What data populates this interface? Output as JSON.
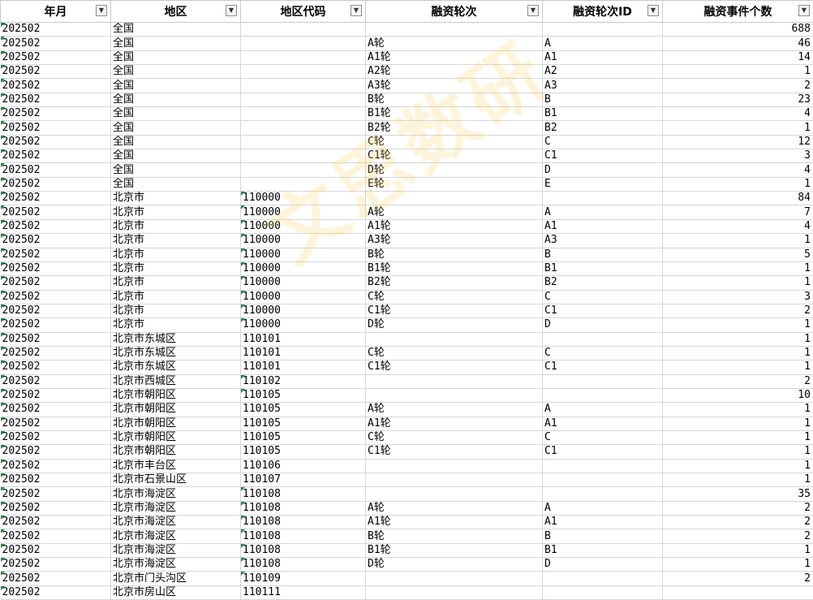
{
  "headers": [
    "年月",
    "地区",
    "地区代码",
    "融资轮次",
    "融资轮次ID",
    "融资事件个数"
  ],
  "filter_icons": [
    "filter-dropdown-icon",
    "filter-dropdown-icon",
    "filter-dropdown-icon",
    "filter-dropdown-icon",
    "filter-dropdown-icon",
    "filter-active-icon"
  ],
  "filter_glyph": "▼",
  "watermark": "文思数研",
  "colors": {
    "marker": "#1e8e3e",
    "watermark": "#f5cd5a"
  },
  "rows": [
    [
      "202502",
      "全国",
      "",
      "",
      "",
      "688"
    ],
    [
      "202502",
      "全国",
      "",
      "A轮",
      "A",
      "46"
    ],
    [
      "202502",
      "全国",
      "",
      "A1轮",
      "A1",
      "14"
    ],
    [
      "202502",
      "全国",
      "",
      "A2轮",
      "A2",
      "1"
    ],
    [
      "202502",
      "全国",
      "",
      "A3轮",
      "A3",
      "2"
    ],
    [
      "202502",
      "全国",
      "",
      "B轮",
      "B",
      "23"
    ],
    [
      "202502",
      "全国",
      "",
      "B1轮",
      "B1",
      "4"
    ],
    [
      "202502",
      "全国",
      "",
      "B2轮",
      "B2",
      "1"
    ],
    [
      "202502",
      "全国",
      "",
      "C轮",
      "C",
      "12"
    ],
    [
      "202502",
      "全国",
      "",
      "C1轮",
      "C1",
      "3"
    ],
    [
      "202502",
      "全国",
      "",
      "D轮",
      "D",
      "4"
    ],
    [
      "202502",
      "全国",
      "",
      "E轮",
      "E",
      "1"
    ],
    [
      "202502",
      "北京市",
      "110000",
      "",
      "",
      "84"
    ],
    [
      "202502",
      "北京市",
      "110000",
      "A轮",
      "A",
      "7"
    ],
    [
      "202502",
      "北京市",
      "110000",
      "A1轮",
      "A1",
      "4"
    ],
    [
      "202502",
      "北京市",
      "110000",
      "A3轮",
      "A3",
      "1"
    ],
    [
      "202502",
      "北京市",
      "110000",
      "B轮",
      "B",
      "5"
    ],
    [
      "202502",
      "北京市",
      "110000",
      "B1轮",
      "B1",
      "1"
    ],
    [
      "202502",
      "北京市",
      "110000",
      "B2轮",
      "B2",
      "1"
    ],
    [
      "202502",
      "北京市",
      "110000",
      "C轮",
      "C",
      "3"
    ],
    [
      "202502",
      "北京市",
      "110000",
      "C1轮",
      "C1",
      "2"
    ],
    [
      "202502",
      "北京市",
      "110000",
      "D轮",
      "D",
      "1"
    ],
    [
      "202502",
      "北京市东城区",
      "110101",
      "",
      "",
      "1"
    ],
    [
      "202502",
      "北京市东城区",
      "110101",
      "C轮",
      "C",
      "1"
    ],
    [
      "202502",
      "北京市东城区",
      "110101",
      "C1轮",
      "C1",
      "1"
    ],
    [
      "202502",
      "北京市西城区",
      "110102",
      "",
      "",
      "2"
    ],
    [
      "202502",
      "北京市朝阳区",
      "110105",
      "",
      "",
      "10"
    ],
    [
      "202502",
      "北京市朝阳区",
      "110105",
      "A轮",
      "A",
      "1"
    ],
    [
      "202502",
      "北京市朝阳区",
      "110105",
      "A1轮",
      "A1",
      "1"
    ],
    [
      "202502",
      "北京市朝阳区",
      "110105",
      "C轮",
      "C",
      "1"
    ],
    [
      "202502",
      "北京市朝阳区",
      "110105",
      "C1轮",
      "C1",
      "1"
    ],
    [
      "202502",
      "北京市丰台区",
      "110106",
      "",
      "",
      "1"
    ],
    [
      "202502",
      "北京市石景山区",
      "110107",
      "",
      "",
      "1"
    ],
    [
      "202502",
      "北京市海淀区",
      "110108",
      "",
      "",
      "35"
    ],
    [
      "202502",
      "北京市海淀区",
      "110108",
      "A轮",
      "A",
      "2"
    ],
    [
      "202502",
      "北京市海淀区",
      "110108",
      "A1轮",
      "A1",
      "2"
    ],
    [
      "202502",
      "北京市海淀区",
      "110108",
      "B轮",
      "B",
      "2"
    ],
    [
      "202502",
      "北京市海淀区",
      "110108",
      "B1轮",
      "B1",
      "1"
    ],
    [
      "202502",
      "北京市海淀区",
      "110108",
      "D轮",
      "D",
      "1"
    ],
    [
      "202502",
      "北京市门头沟区",
      "110109",
      "",
      "",
      "2"
    ],
    [
      "202502",
      "北京市房山区",
      "110111",
      "",
      "",
      ""
    ]
  ],
  "code_markers": [
    true,
    true,
    true,
    true,
    true,
    true,
    true,
    true,
    true,
    true,
    true,
    true,
    true,
    true,
    true,
    true,
    true,
    true,
    true,
    true,
    true,
    true,
    false,
    false,
    false,
    true,
    true,
    false,
    false,
    false,
    false,
    false,
    false,
    true,
    true,
    true,
    true,
    true,
    true,
    true,
    false
  ]
}
